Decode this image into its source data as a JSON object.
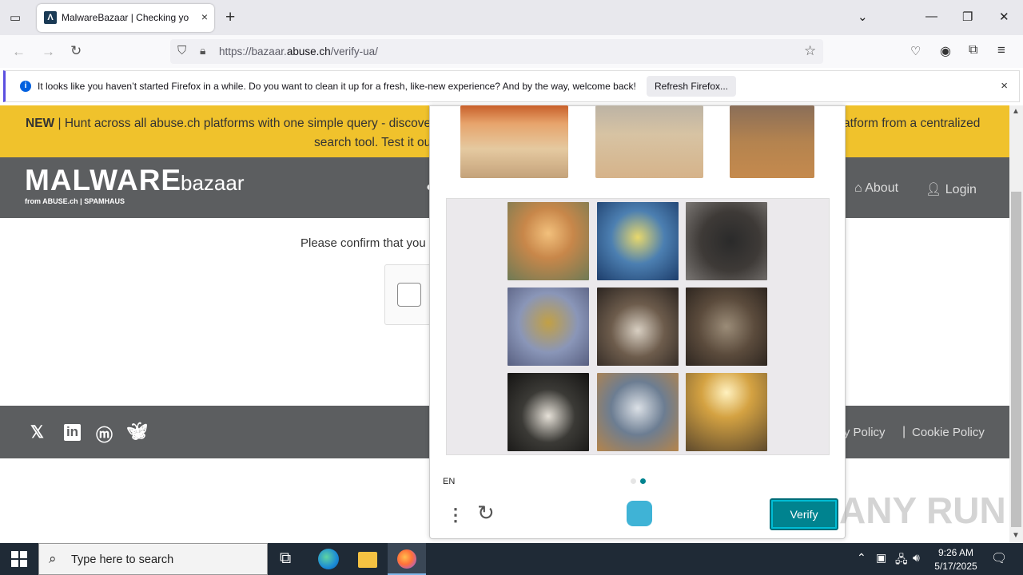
{
  "browser": {
    "tab_title": "MalwareBazaar | Checking your",
    "url_prefix": "https://bazaar.",
    "url_domain": "abuse.ch",
    "url_path": "/verify-ua/"
  },
  "notification": {
    "text": "It looks like you haven’t started Firefox in a while. Do you want to clean it up for a fresh, like-new experience? And by the way, welcome back!",
    "button": "Refresh Firefox..."
  },
  "page": {
    "banner_new": "NEW",
    "banner_line1": "| Hunt across all abuse.ch platforms with one simple query - discove",
    "banner_line1_end": "atform from a centralized",
    "banner_line2": "search tool. Test it ou",
    "logo_main": "MALWARE",
    "logo_sub": "bazaar",
    "logo_from": "from ABUSE.ch | SPAMHAUS",
    "nav_about": "About",
    "nav_login": "Login",
    "confirm_text": "Please confirm that you",
    "footer_privacy": "acy Policy",
    "footer_sep": "|",
    "footer_cookie": "Cookie Policy"
  },
  "captcha": {
    "language": "EN",
    "verify_label": "Verify",
    "watermark": "ANY RUN"
  },
  "taskbar": {
    "search_placeholder": "Type here to search",
    "time": "9:26 AM",
    "date": "5/17/2025"
  },
  "icons": {
    "tab_close": "×",
    "new_tab": "+",
    "back": "←",
    "forward": "→",
    "reload": "↻",
    "info": "i",
    "close": "×"
  }
}
